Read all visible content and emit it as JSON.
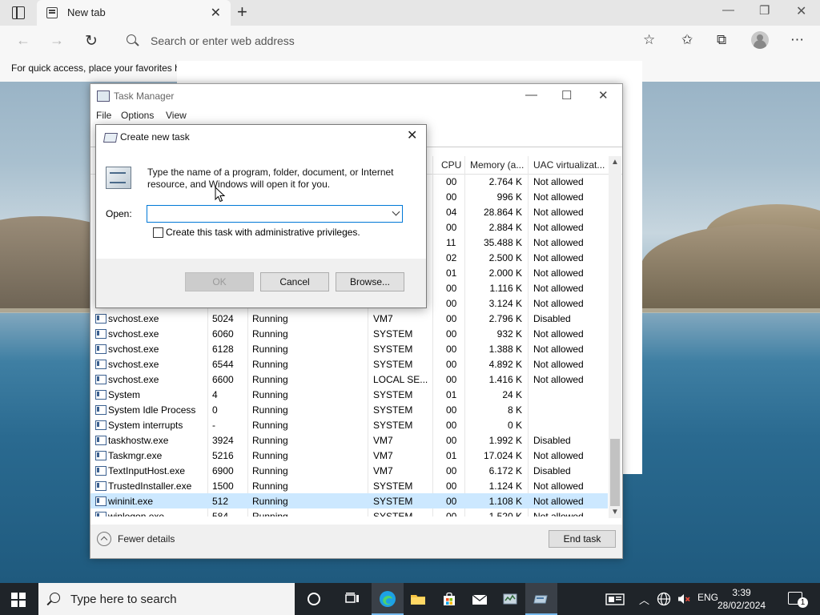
{
  "browser": {
    "tab_title": "New tab",
    "address_placeholder": "Search or enter web address",
    "favorites_bar_text": "For quick access, place your favorites h"
  },
  "task_manager": {
    "title": "Task Manager",
    "menus": [
      "File",
      "Options",
      "View"
    ],
    "columns": {
      "cpu": "CPU",
      "memory": "Memory (a...",
      "uac": "UAC virtualizat..."
    },
    "partial_rows": [
      {
        "cpu": "00",
        "mem": "2.764 K",
        "uac": "Not allowed"
      },
      {
        "cpu": "00",
        "mem": "996 K",
        "uac": "Not allowed"
      },
      {
        "cpu": "04",
        "mem": "28.864 K",
        "uac": "Not allowed"
      },
      {
        "cpu": "00",
        "mem": "2.884 K",
        "uac": "Not allowed"
      },
      {
        "cpu": "11",
        "mem": "35.488 K",
        "uac": "Not allowed"
      },
      {
        "cpu": "02",
        "mem": "2.500 K",
        "uac": "Not allowed"
      },
      {
        "cpu": "01",
        "mem": "2.000 K",
        "uac": "Not allowed"
      },
      {
        "cpu": "00",
        "mem": "1.116 K",
        "uac": "Not allowed"
      },
      {
        "cpu": "00",
        "mem": "3.124 K",
        "uac": "Not allowed"
      }
    ],
    "rows": [
      {
        "name": "svchost.exe",
        "pid": "5024",
        "status": "Running",
        "user": "VM7",
        "cpu": "00",
        "mem": "2.796 K",
        "uac": "Disabled"
      },
      {
        "name": "svchost.exe",
        "pid": "6060",
        "status": "Running",
        "user": "SYSTEM",
        "cpu": "00",
        "mem": "932 K",
        "uac": "Not allowed"
      },
      {
        "name": "svchost.exe",
        "pid": "6128",
        "status": "Running",
        "user": "SYSTEM",
        "cpu": "00",
        "mem": "1.388 K",
        "uac": "Not allowed"
      },
      {
        "name": "svchost.exe",
        "pid": "6544",
        "status": "Running",
        "user": "SYSTEM",
        "cpu": "00",
        "mem": "4.892 K",
        "uac": "Not allowed"
      },
      {
        "name": "svchost.exe",
        "pid": "6600",
        "status": "Running",
        "user": "LOCAL SE...",
        "cpu": "00",
        "mem": "1.416 K",
        "uac": "Not allowed"
      },
      {
        "name": "System",
        "pid": "4",
        "status": "Running",
        "user": "SYSTEM",
        "cpu": "01",
        "mem": "24 K",
        "uac": ""
      },
      {
        "name": "System Idle Process",
        "pid": "0",
        "status": "Running",
        "user": "SYSTEM",
        "cpu": "00",
        "mem": "8 K",
        "uac": ""
      },
      {
        "name": "System interrupts",
        "pid": "-",
        "status": "Running",
        "user": "SYSTEM",
        "cpu": "00",
        "mem": "0 K",
        "uac": ""
      },
      {
        "name": "taskhostw.exe",
        "pid": "3924",
        "status": "Running",
        "user": "VM7",
        "cpu": "00",
        "mem": "1.992 K",
        "uac": "Disabled"
      },
      {
        "name": "Taskmgr.exe",
        "pid": "5216",
        "status": "Running",
        "user": "VM7",
        "cpu": "01",
        "mem": "17.024 K",
        "uac": "Not allowed"
      },
      {
        "name": "TextInputHost.exe",
        "pid": "6900",
        "status": "Running",
        "user": "VM7",
        "cpu": "00",
        "mem": "6.172 K",
        "uac": "Disabled"
      },
      {
        "name": "TrustedInstaller.exe",
        "pid": "1500",
        "status": "Running",
        "user": "SYSTEM",
        "cpu": "00",
        "mem": "1.124 K",
        "uac": "Not allowed"
      },
      {
        "name": "wininit.exe",
        "pid": "512",
        "status": "Running",
        "user": "SYSTEM",
        "cpu": "00",
        "mem": "1.108 K",
        "uac": "Not allowed",
        "selected": true
      },
      {
        "name": "winlogon.exe",
        "pid": "584",
        "status": "Running",
        "user": "SYSTEM",
        "cpu": "00",
        "mem": "1.520 K",
        "uac": "Not allowed"
      }
    ],
    "fewer_details": "Fewer details",
    "end_task": "End task"
  },
  "dialog": {
    "title": "Create new task",
    "message": "Type the name of a program, folder, document, or Internet resource, and Windows will open it for you.",
    "open_label": "Open:",
    "open_value": "",
    "checkbox_label": "Create this task with administrative privileges.",
    "ok": "OK",
    "cancel": "Cancel",
    "browse": "Browse..."
  },
  "taskbar": {
    "search_placeholder": "Type here to search",
    "language": "ENG",
    "time": "3:39",
    "date": "28/02/2024",
    "notification_count": "1"
  }
}
